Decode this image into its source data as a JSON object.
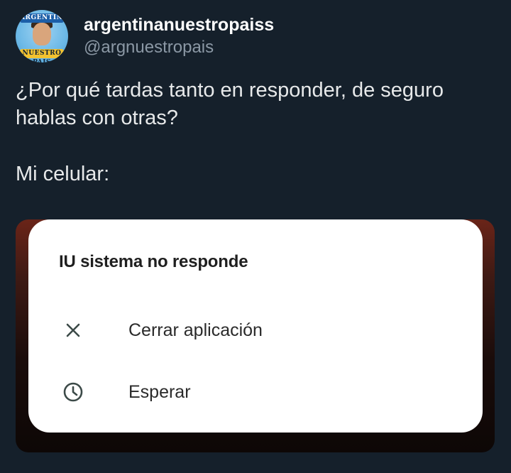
{
  "author": {
    "display_name": "argentinanuestropaiss",
    "handle": "@argnuestropais",
    "avatar_text_top": "ARGENTINA",
    "avatar_text_bottom": "NUESTRO PAIS"
  },
  "tweet": {
    "line1": "¿Por qué tardas tanto en responder, de seguro hablas con otras?",
    "line2": "Mi celular:"
  },
  "dialog": {
    "title": "IU sistema no responde",
    "options": [
      {
        "label": "Cerrar aplicación",
        "icon": "close-icon"
      },
      {
        "label": "Esperar",
        "icon": "clock-icon"
      }
    ]
  },
  "colors": {
    "background": "#15202b",
    "text": "#e7e9ea",
    "muted": "#8b98a5",
    "dialog_bg": "#ffffff",
    "icon": "#3c4a48"
  }
}
